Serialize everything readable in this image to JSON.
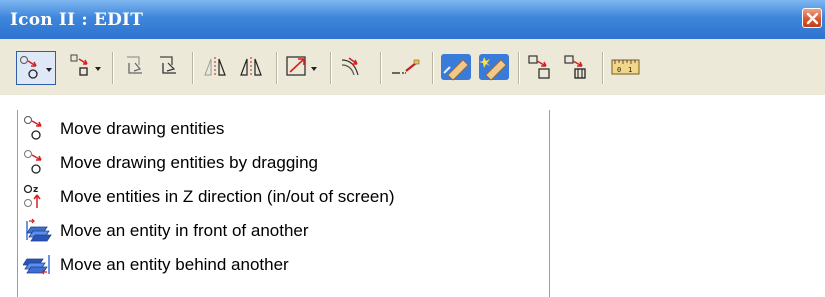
{
  "window": {
    "title": "Icon II : EDIT"
  },
  "toolbar": {
    "buttons": [
      {
        "icon": "move-entities-icon",
        "has_dropdown": true,
        "active": true
      },
      {
        "icon": "copy-entities-icon",
        "has_dropdown": true
      },
      {
        "icon": "rotate-left-icon"
      },
      {
        "icon": "rotate-right-icon"
      },
      {
        "icon": "mirror-icon"
      },
      {
        "icon": "mirror-copy-icon"
      },
      {
        "icon": "scale-icon",
        "has_dropdown": true
      },
      {
        "icon": "offset-icon"
      },
      {
        "icon": "trim-icon"
      },
      {
        "icon": "eraser-icon"
      },
      {
        "icon": "eraser-new-icon"
      },
      {
        "icon": "group-icon"
      },
      {
        "icon": "explode-icon"
      },
      {
        "icon": "measure-icon"
      }
    ]
  },
  "menu": {
    "items": [
      {
        "label": "Move drawing entities",
        "icon": "move-drawing-entities-icon"
      },
      {
        "label": "Move drawing entities by dragging",
        "icon": "move-by-dragging-icon"
      },
      {
        "label": "Move entities in Z direction (in/out of screen)",
        "icon": "move-z-direction-icon"
      },
      {
        "label": "Move an entity in front of another",
        "icon": "bring-to-front-icon"
      },
      {
        "label": "Move an entity behind another",
        "icon": "send-to-back-icon"
      }
    ]
  },
  "colors": {
    "titlebar": "#2d73cf",
    "toolbar_bg": "#ece9d8",
    "close_button": "#d8562f",
    "active_button_border": "#2f5fa8"
  }
}
